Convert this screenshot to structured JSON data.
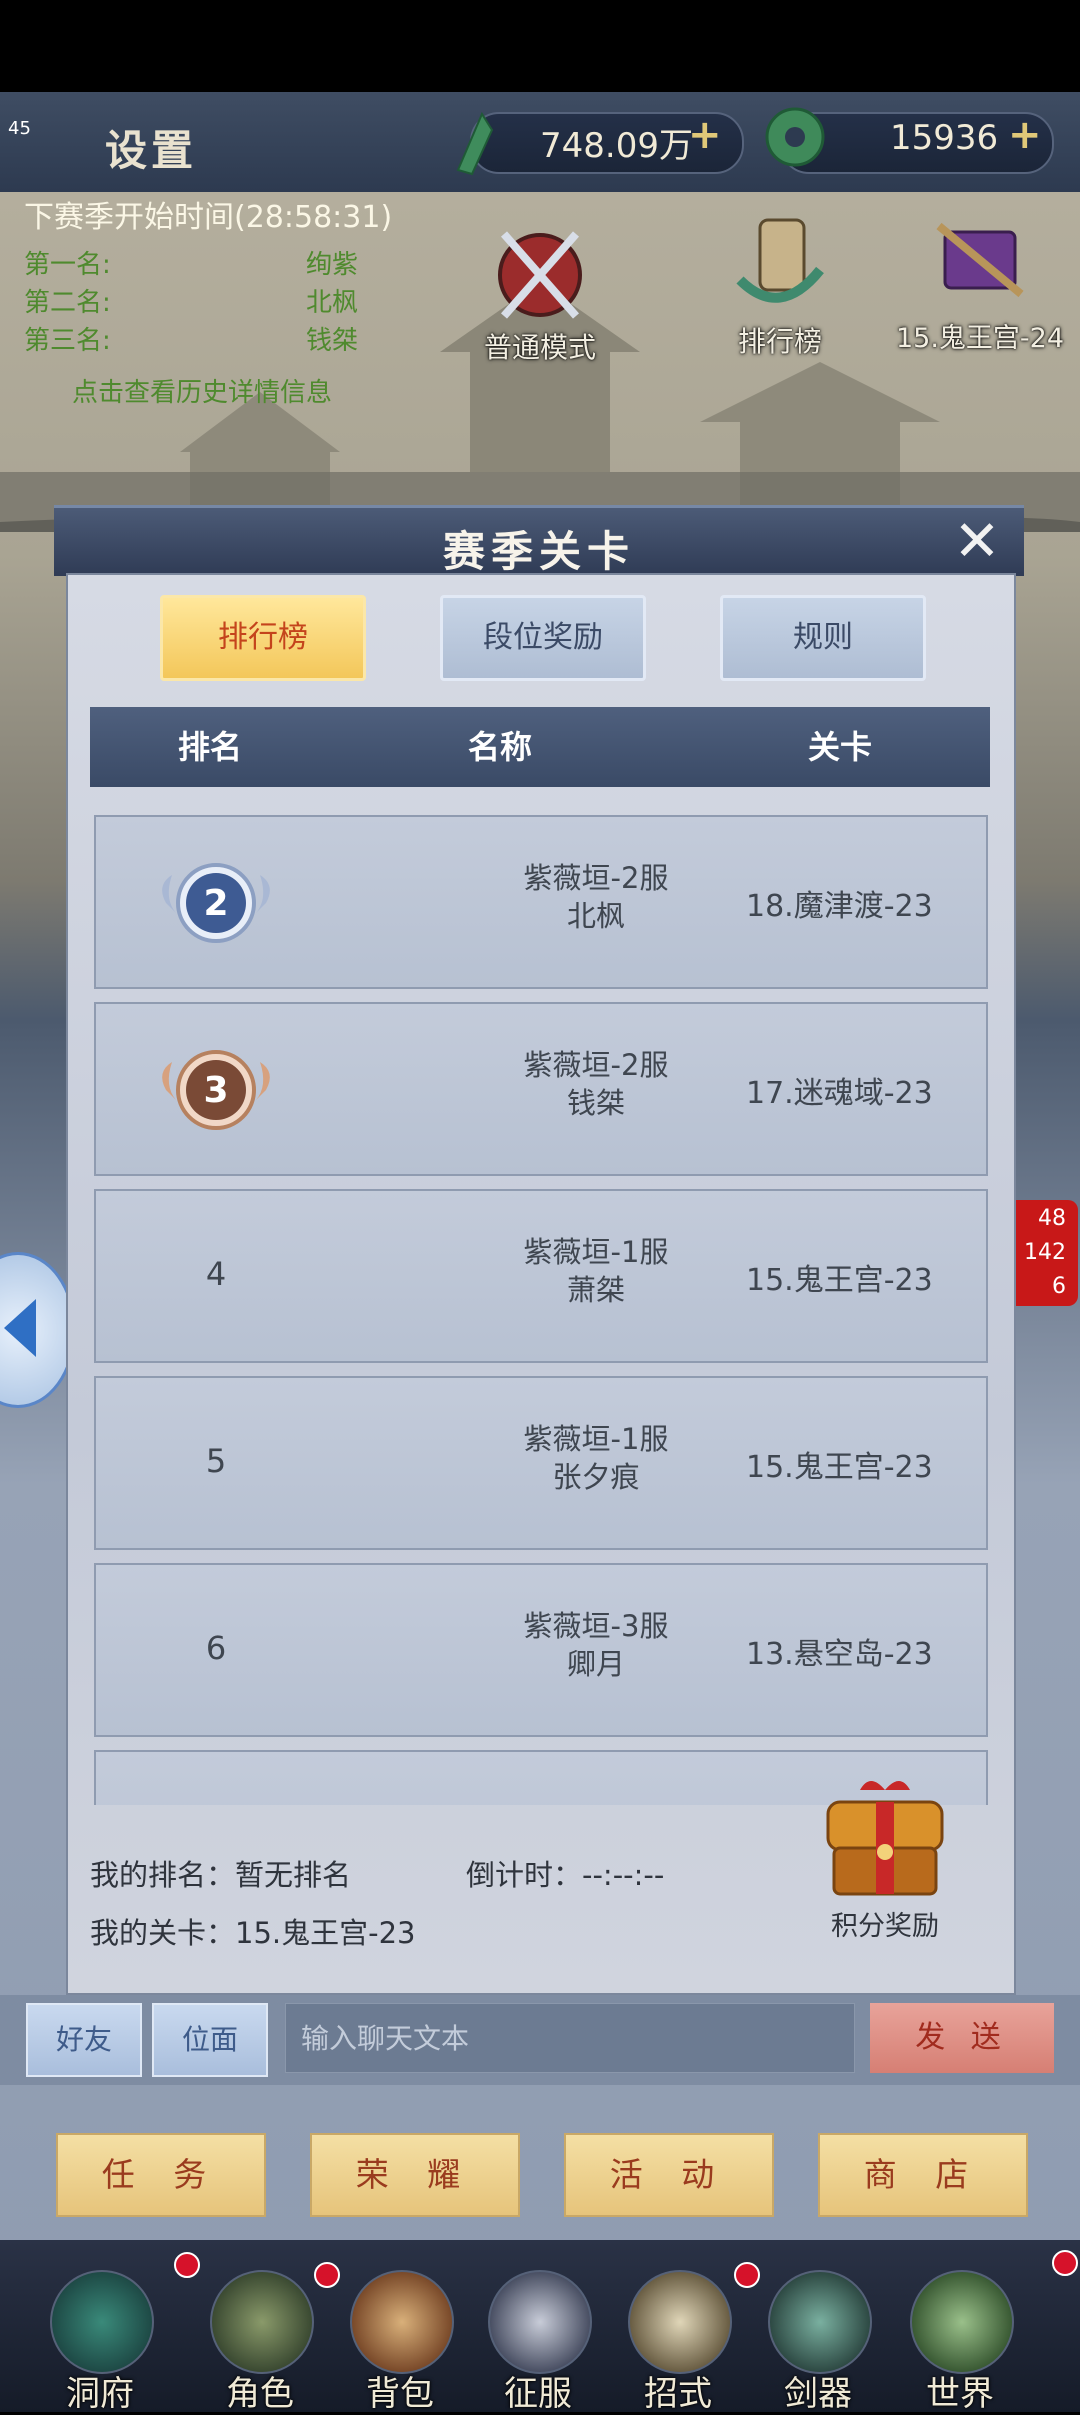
{
  "status": {
    "fps": "45"
  },
  "header": {
    "title": "设置",
    "currency1": {
      "value": "748.09万",
      "icon": "jade-gem-icon"
    },
    "currency2": {
      "value": "15936",
      "icon": "jade-coin-icon"
    }
  },
  "season": {
    "next_start": "下赛季开始时间(28:58:31)",
    "ranks": [
      {
        "label": "第一名:",
        "name": "绚紫"
      },
      {
        "label": "第二名:",
        "name": "北枫"
      },
      {
        "label": "第三名:",
        "name": "钱桀"
      }
    ],
    "detail_link": "点击查看历史详情信息"
  },
  "features": {
    "mode": "普通模式",
    "ranking": "排行榜",
    "level": "15.鬼王宫-24"
  },
  "dialog": {
    "title": "赛季关卡",
    "close_icon": "close-icon",
    "tabs": [
      "排行榜",
      "段位奖励",
      "规则"
    ],
    "active_tab": 0,
    "columns": [
      "排名",
      "名称",
      "关卡"
    ],
    "rows": [
      {
        "rank": "2",
        "server": "紫薇垣-2服",
        "player": "北枫",
        "level": "18.魔津渡-23",
        "medal": "silver"
      },
      {
        "rank": "3",
        "server": "紫薇垣-2服",
        "player": "钱桀",
        "level": "17.迷魂域-23",
        "medal": "bronze"
      },
      {
        "rank": "4",
        "server": "紫薇垣-1服",
        "player": "萧桀",
        "level": "15.鬼王宫-23",
        "medal": ""
      },
      {
        "rank": "5",
        "server": "紫薇垣-1服",
        "player": "张夕痕",
        "level": "15.鬼王宫-23",
        "medal": ""
      },
      {
        "rank": "6",
        "server": "紫薇垣-3服",
        "player": "卿月",
        "level": "13.悬空岛-23",
        "medal": ""
      }
    ],
    "footer": {
      "my_rank": "我的排名：暂无排名",
      "countdown": "倒计时：--:--:--",
      "my_level": "我的关卡：15.鬼王宫-23",
      "reward_label": "积分奖励"
    }
  },
  "side_badge": {
    "info": "48",
    "warn": "142",
    "error": "6"
  },
  "chat": {
    "friends": "好友",
    "plane": "位面",
    "placeholder": "输入聊天文本",
    "send": "发 送"
  },
  "actions": [
    "任 务",
    "荣 耀",
    "活 动",
    "商 店"
  ],
  "nav": [
    "洞府",
    "角色",
    "背包",
    "征服",
    "招式",
    "剑器",
    "世界"
  ],
  "colors": {
    "accent_gold": "#f3c75a",
    "header_blue": "#3a4a66",
    "badge_red": "#c81818"
  }
}
